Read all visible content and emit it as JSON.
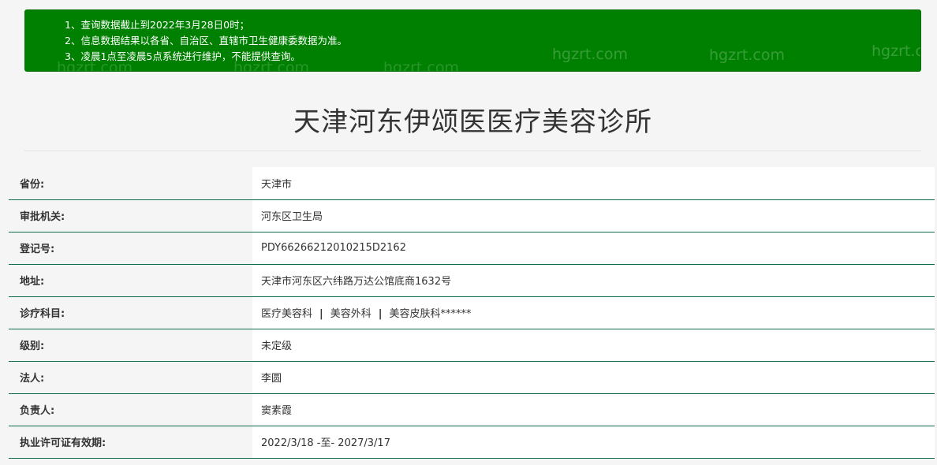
{
  "notice": {
    "lines": [
      "1、查询数据截止到2022年3月28日0时；",
      "2、信息数据结果以各省、自治区、直辖市卫生健康委数据为准。",
      "3、凌晨1点至凌晨5点系统进行维护，不能提供查询。"
    ],
    "watermark": "hgzrt.com"
  },
  "clinic": {
    "name": "天津河东伊颂医医疗美容诊所"
  },
  "fields": [
    {
      "label": "省份:",
      "value": "天津市"
    },
    {
      "label": "审批机关:",
      "value": "河东区卫生局"
    },
    {
      "label": "登记号:",
      "value": "PDY66266212010215D2162"
    },
    {
      "label": "地址:",
      "value": "天津市河东区六纬路万达公馆底商1632号"
    },
    {
      "label": "诊疗科目:",
      "departments": [
        "医疗美容科",
        "美容外科",
        "美容皮肤科******"
      ],
      "separator": "|"
    },
    {
      "label": "级别:",
      "value": "未定级"
    },
    {
      "label": "法人:",
      "value": "李圆"
    },
    {
      "label": "负责人:",
      "value": "窦素霞"
    },
    {
      "label": "执业许可证有效期:",
      "value": "2022/3/18 -至- 2027/3/17"
    }
  ],
  "colors": {
    "notice_bg": "#008000",
    "row_border": "#0e6b4a",
    "page_bg": "#f5f5f5"
  }
}
